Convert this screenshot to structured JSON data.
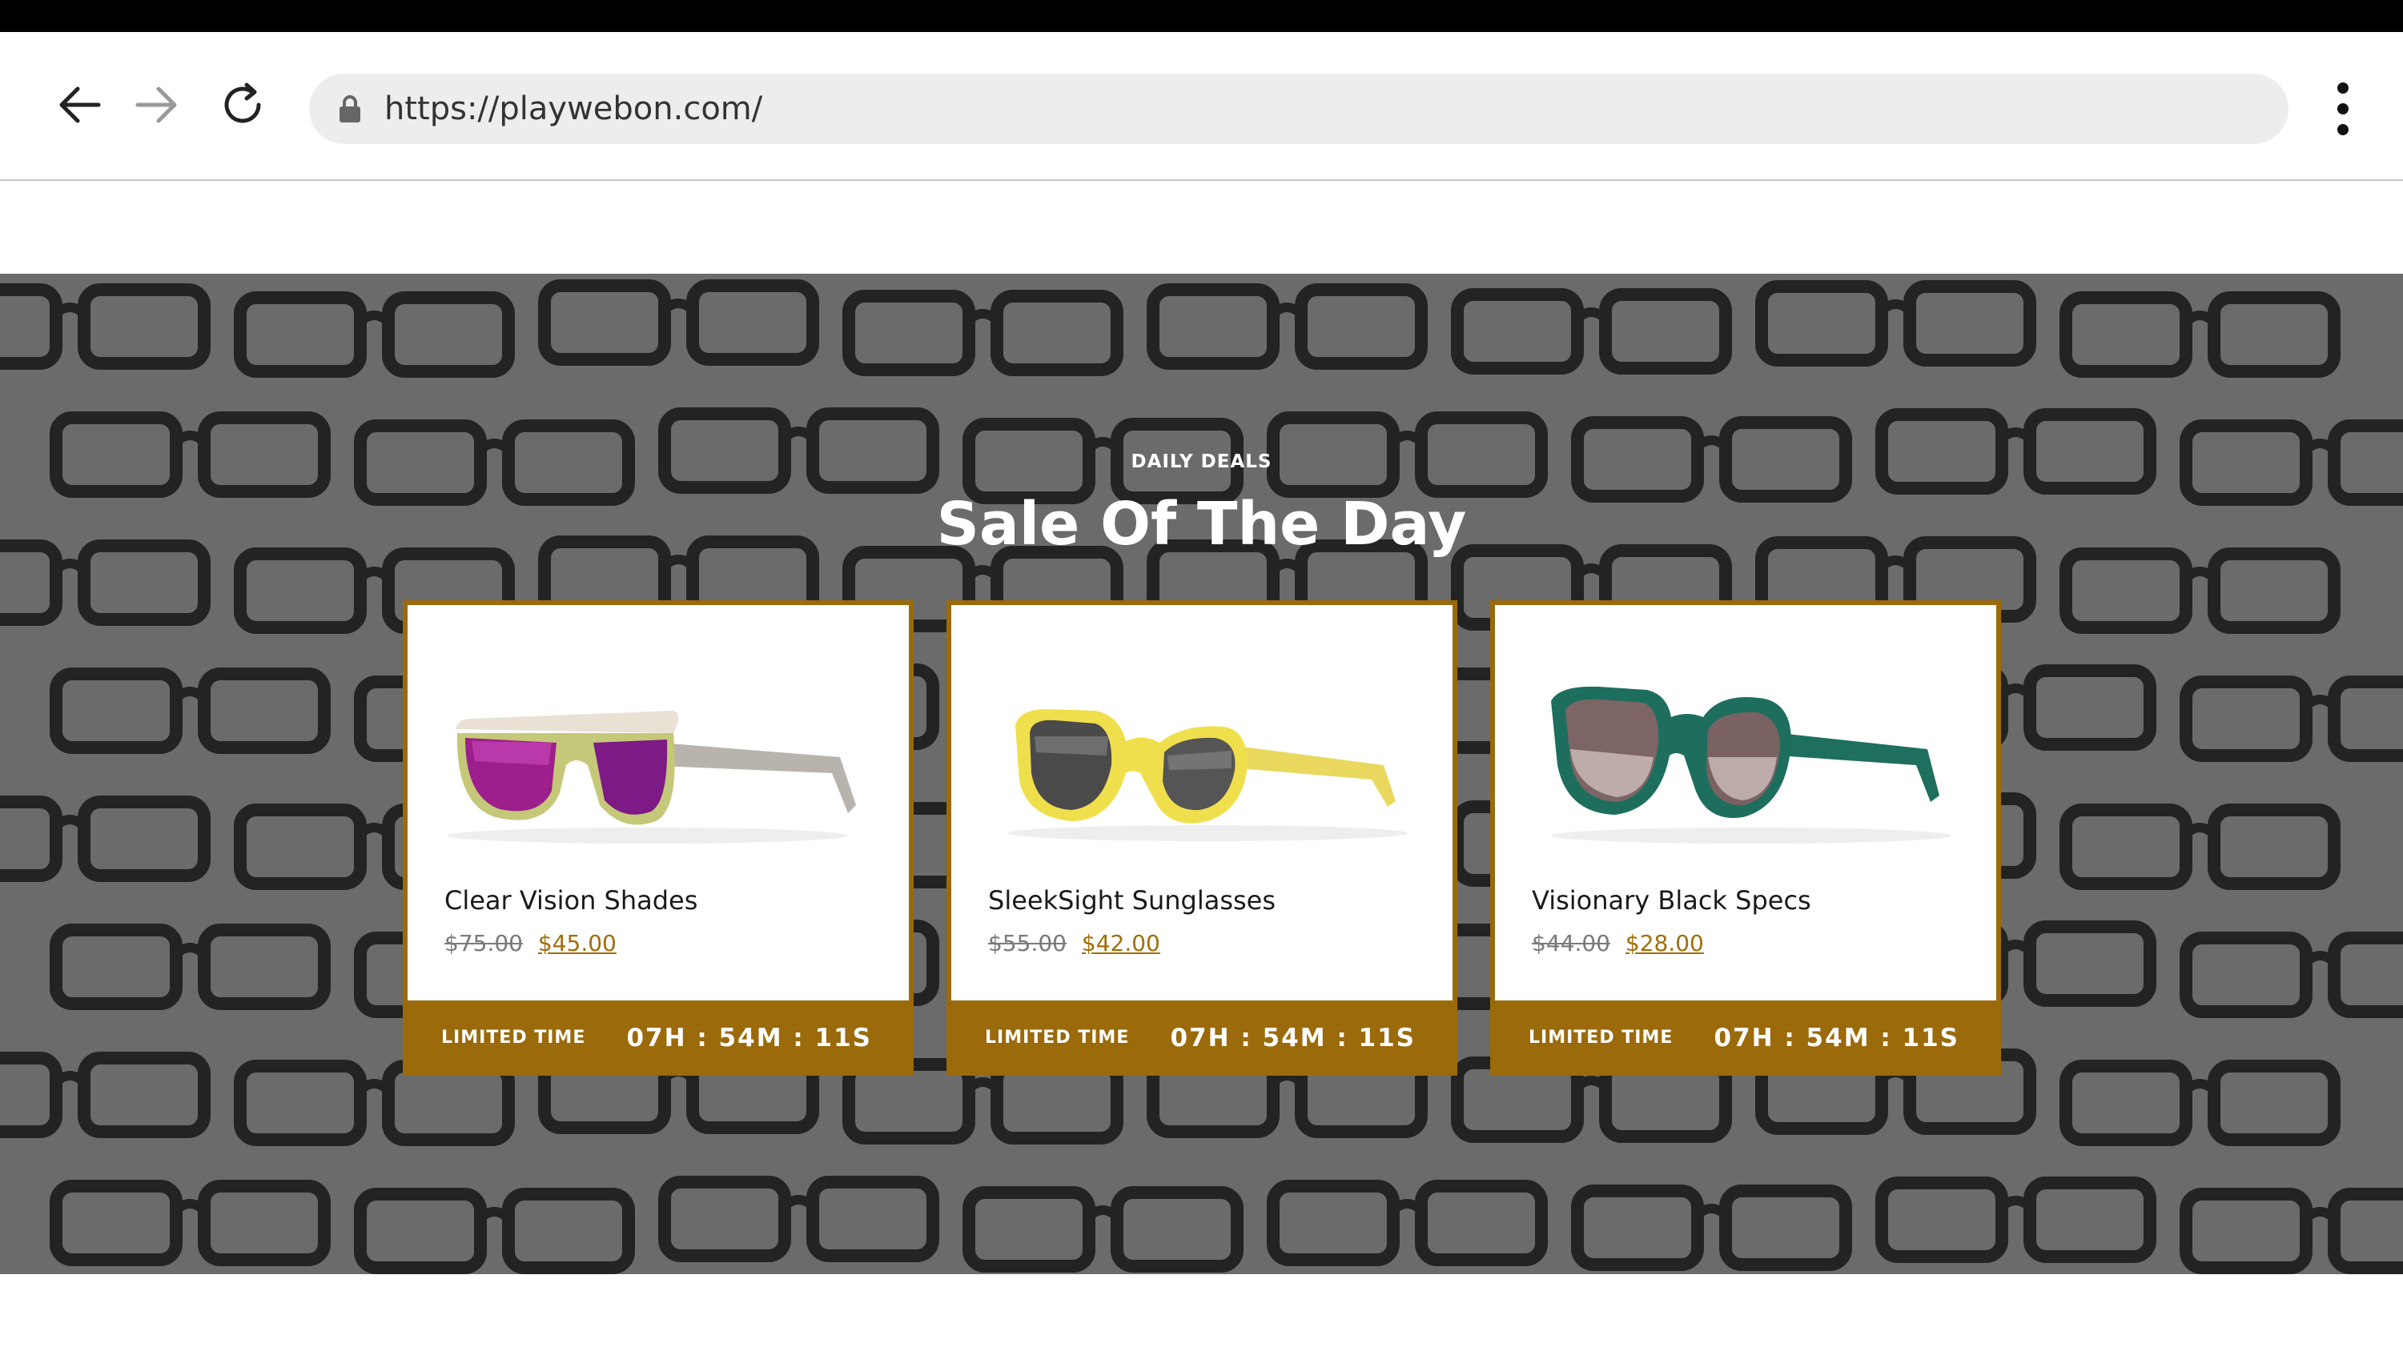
{
  "browser": {
    "url": "https://playwebon.com/",
    "icons": {
      "back": "arrow-left-icon",
      "forward": "arrow-right-icon",
      "reload": "reload-icon",
      "lock": "lock-icon",
      "menu": "kebab-menu-icon"
    }
  },
  "hero": {
    "kicker": "DAILY DEALS",
    "title": "Sale Of The Day",
    "background": "eyeglass-frames-display-photo"
  },
  "products": [
    {
      "name": "Clear Vision Shades",
      "old_price": "$75.00",
      "new_price": "$45.00",
      "limited_label": "LIMITED TIME",
      "countdown": "07H : 54M : 11S",
      "image": "sunglasses-cream-purple-lens"
    },
    {
      "name": "SleekSight Sunglasses",
      "old_price": "$55.00",
      "new_price": "$42.00",
      "limited_label": "LIMITED TIME",
      "countdown": "07H : 54M : 11S",
      "image": "sunglasses-yellow-grey-lens"
    },
    {
      "name": "Visionary Black Specs",
      "old_price": "$44.00",
      "new_price": "$28.00",
      "limited_label": "LIMITED TIME",
      "countdown": "07H : 54M : 11S",
      "image": "sunglasses-teal-gradient-lens"
    }
  ],
  "colors": {
    "accent": "#9b6a0a",
    "price": "#a06e0a",
    "hero_overlay": "#262626"
  }
}
